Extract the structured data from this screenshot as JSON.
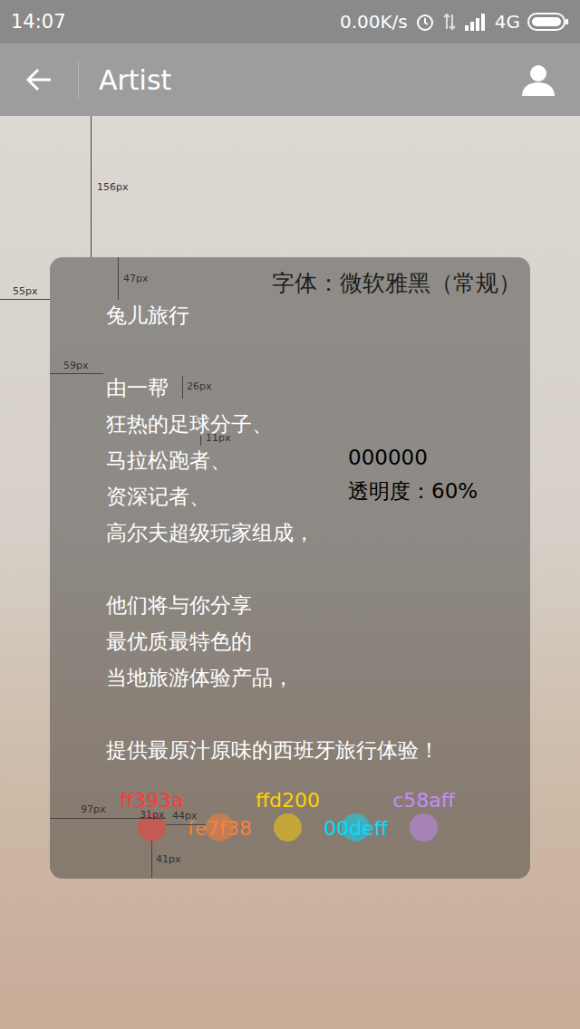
{
  "status_bar": {
    "time": "14:07",
    "speed": "0.00K/s",
    "network": "4G"
  },
  "app_bar": {
    "title": "Artist"
  },
  "card": {
    "font_note": "字体：微软雅黑（常规）",
    "color_note": [
      "000000",
      "透明度：60%"
    ],
    "paragraphs": [
      [
        "兔儿旅行"
      ],
      [
        "由一帮",
        "狂热的足球分子、",
        "马拉松跑者、",
        "资深记者、",
        "高尔夫超级玩家组成，"
      ],
      [
        "他们将与你分享",
        "最优质最特色的",
        "当地旅游体验产品，"
      ],
      [
        "提供最原汁原味的西班牙旅行体验！"
      ]
    ]
  },
  "dots": [
    {
      "label": "ff393a",
      "color": "#ff393a"
    },
    {
      "label": "fe7f38",
      "color": "#fe7f38"
    },
    {
      "label": "ffd200",
      "color": "#ffd200"
    },
    {
      "label": "00deff",
      "color": "#00deff"
    },
    {
      "label": "c58aff",
      "color": "#c58aff"
    }
  ],
  "measurements": [
    {
      "label": "156px"
    },
    {
      "label": "47px"
    },
    {
      "label": "55px"
    },
    {
      "label": "59px"
    },
    {
      "label": "26px"
    },
    {
      "label": "11px"
    },
    {
      "label": "97px"
    },
    {
      "label": "31px"
    },
    {
      "label": "44px"
    },
    {
      "label": "41px"
    }
  ]
}
